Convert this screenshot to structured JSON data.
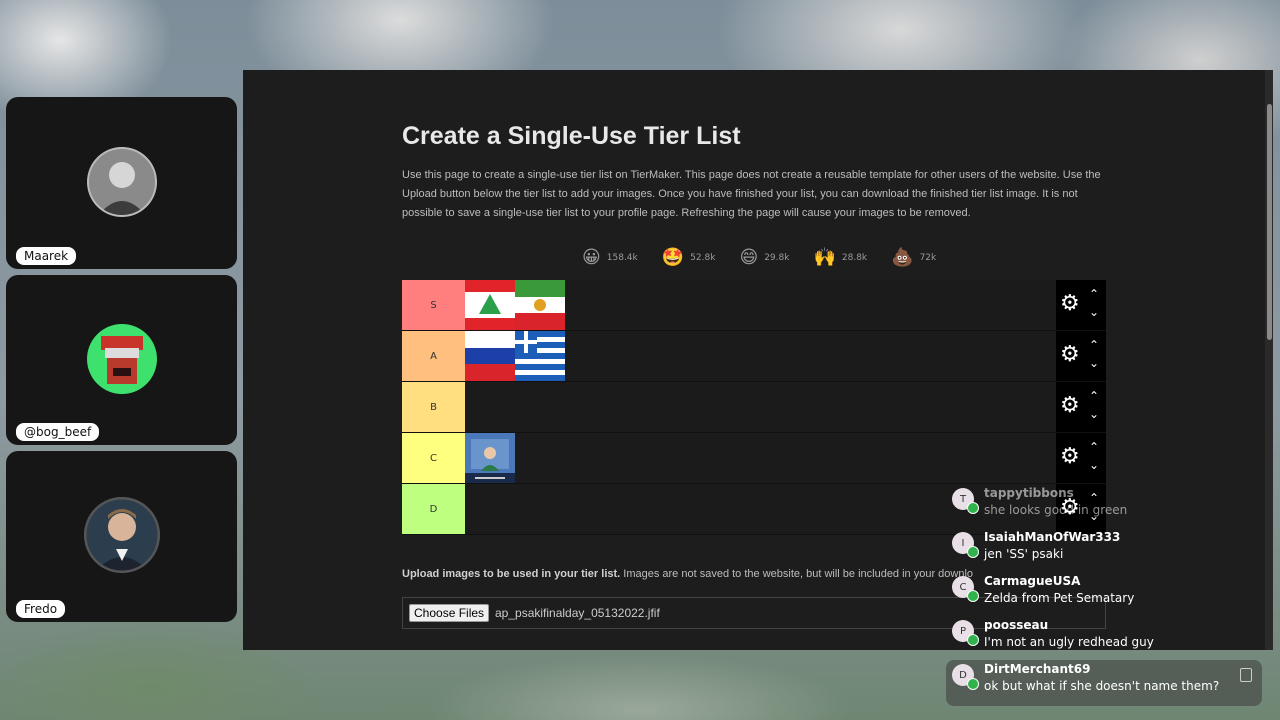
{
  "participants": [
    {
      "name": "Maarek"
    },
    {
      "name": "@bog_beef"
    },
    {
      "name": "Fredo"
    }
  ],
  "page": {
    "title": "Create a Single-Use Tier List",
    "description": "Use this page to create a single-use tier list on TierMaker. This page does not create a reusable template for other users of the website. Use the Upload button below the tier list to add your images. Once you have finished your list, you can download the finished tier list image. It is not possible to save a single-use tier list to your profile page. Refreshing the page will cause your images to be removed."
  },
  "reactions": [
    {
      "icon": "grinning-face-icon",
      "emoji": "😀",
      "count": "158.4k"
    },
    {
      "icon": "star-eyes-icon",
      "emoji": "🤩",
      "count": "52.8k"
    },
    {
      "icon": "laughing-face-icon",
      "emoji": "😄",
      "count": "29.8k"
    },
    {
      "icon": "raised-hands-icon",
      "emoji": "🙌",
      "count": "28.8k"
    },
    {
      "icon": "poop-icon",
      "emoji": "💩",
      "count": "72k"
    }
  ],
  "tiers": [
    {
      "label": "S",
      "color": "#ff7f7f"
    },
    {
      "label": "A",
      "color": "#ffbf7f"
    },
    {
      "label": "B",
      "color": "#ffdf7f"
    },
    {
      "label": "C",
      "color": "#ffff7f"
    },
    {
      "label": "D",
      "color": "#bfff7f"
    }
  ],
  "upload": {
    "bold": "Upload images to be used in your tier list.",
    "rest": " Images are not saved to the website, but will be included in your downlo",
    "button": "Choose Files",
    "filename": "ap_psakifinalday_05132022.jfif"
  },
  "chat": [
    {
      "initial": "T",
      "user": "tappytibbons",
      "message": "she looks good in green"
    },
    {
      "initial": "I",
      "user": "IsaiahManOfWar333",
      "message": "jen 'SS' psaki"
    },
    {
      "initial": "C",
      "user": "CarmagueUSA",
      "message": "Zelda from Pet Sematary"
    },
    {
      "initial": "P",
      "user": "poosseau",
      "message": "I'm not an ugly redhead guy"
    },
    {
      "initial": "D",
      "user": "DirtMerchant69",
      "message": "ok but what if she doesn't name them?"
    }
  ]
}
